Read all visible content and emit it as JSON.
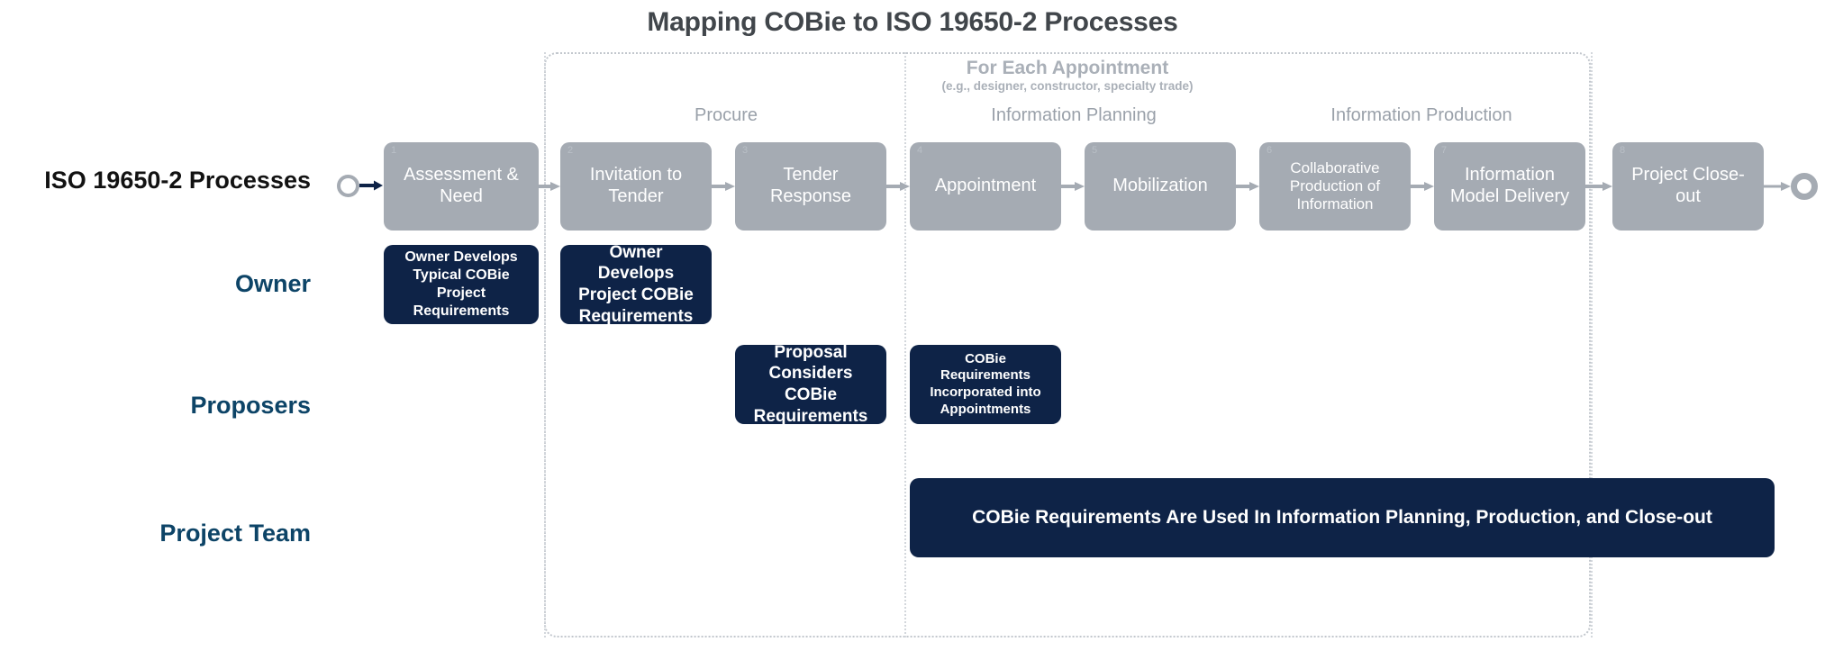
{
  "title": "Mapping COBie to ISO 19650-2 Processes",
  "appointment_group": {
    "heading": "For Each Appointment",
    "subtitle": "(e.g., designer, constructor, specialty trade)"
  },
  "phases": [
    {
      "label": "Procure"
    },
    {
      "label": "Information Planning"
    },
    {
      "label": "Information Production"
    }
  ],
  "rows": [
    {
      "label": "ISO 19650-2 Processes"
    },
    {
      "label": "Owner"
    },
    {
      "label": "Proposers"
    },
    {
      "label": "Project Team"
    }
  ],
  "processes": [
    {
      "num": "1",
      "label": "Assessment & Need"
    },
    {
      "num": "2",
      "label": "Invitation to Tender"
    },
    {
      "num": "3",
      "label": "Tender Response"
    },
    {
      "num": "4",
      "label": "Appointment"
    },
    {
      "num": "5",
      "label": "Mobilization"
    },
    {
      "num": "6",
      "label": "Collaborative Production of Information"
    },
    {
      "num": "7",
      "label": "Information Model Delivery"
    },
    {
      "num": "8",
      "label": "Project Close-out"
    }
  ],
  "owner_activities": [
    {
      "label": "Owner Develops Typical COBie Project Requirements"
    },
    {
      "label": "Owner Develops Project COBie Requirements"
    }
  ],
  "proposer_activities": [
    {
      "label": "Proposal Considers COBie Requirements"
    },
    {
      "label": "COBie Requirements Incorporated into Appointments"
    }
  ],
  "project_team_activities": [
    {
      "label": "COBie Requirements Are Used In Information Planning, Production, and Close-out"
    }
  ],
  "colors": {
    "process_box": "#a5abb3",
    "activity_box": "#0e2347",
    "lane_label": "#0d4467",
    "phase_label": "#9aa1aa",
    "title": "#41464b",
    "frame": "#c2c7cd",
    "start_arrow": "#0e2347",
    "flow_arrow": "#a5abb3"
  }
}
